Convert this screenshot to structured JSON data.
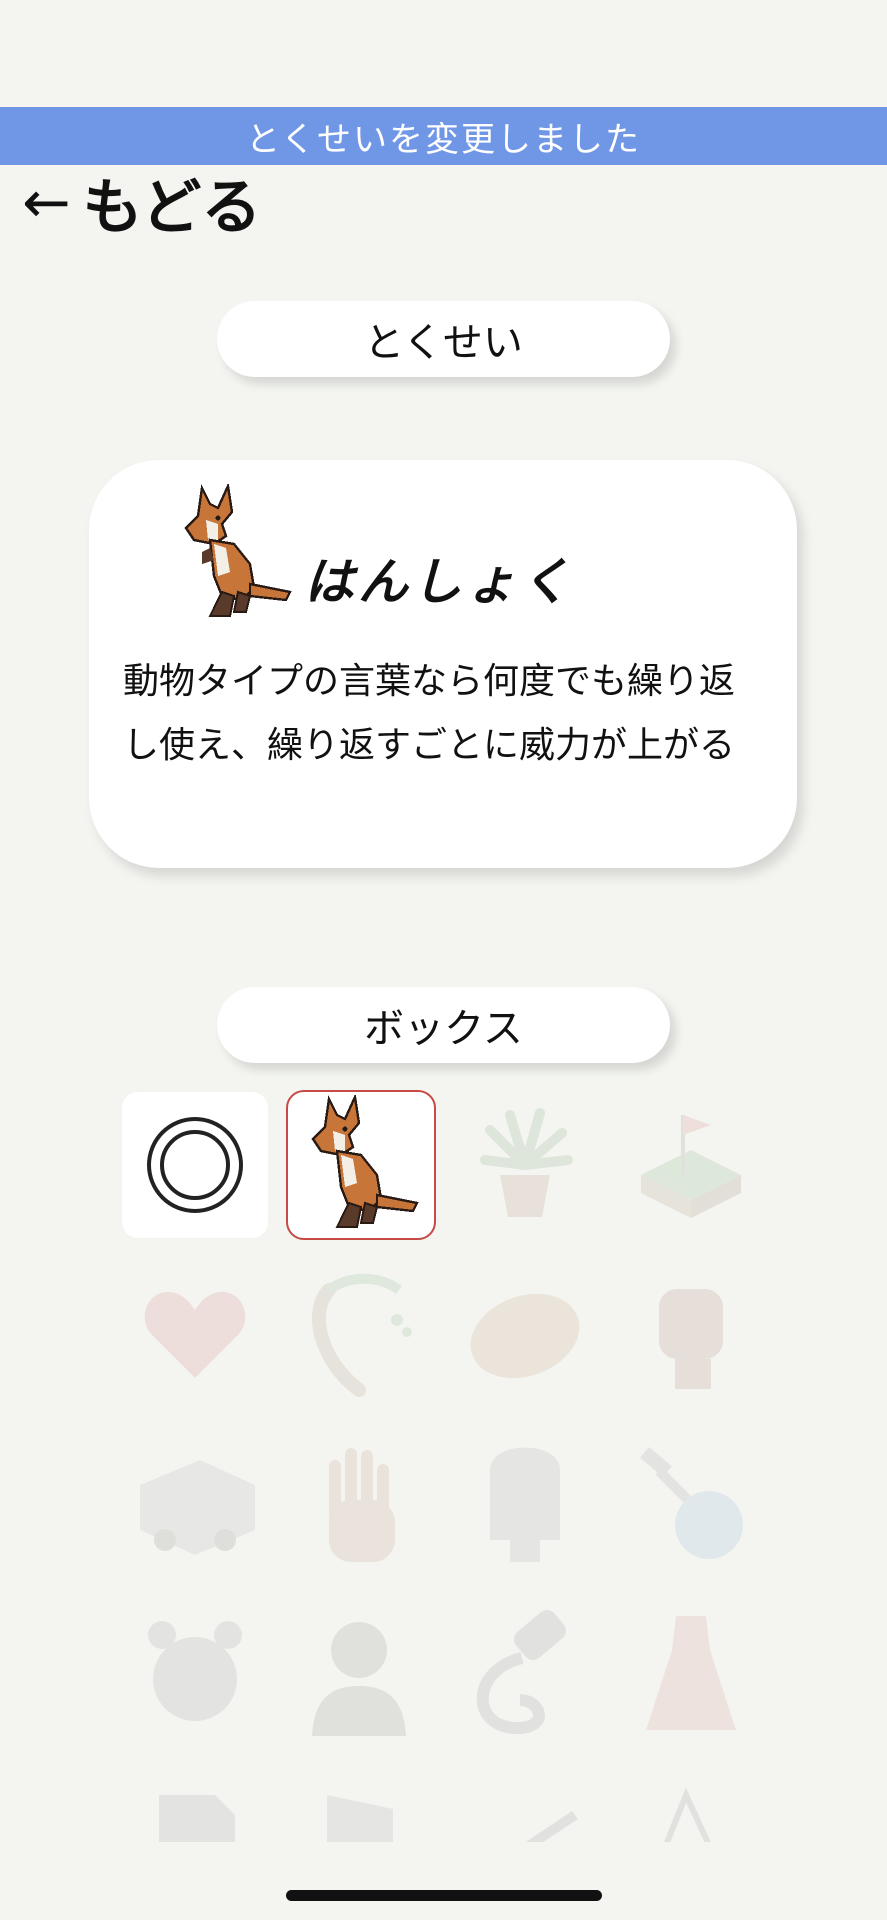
{
  "toast": {
    "text": "とくせいを変更しました"
  },
  "nav": {
    "back_arrow": "←",
    "back_label": "もどる"
  },
  "ability_section": {
    "title": "とくせい"
  },
  "ability_card": {
    "name": "はんしょく",
    "description": "動物タイプの言葉なら何度でも繰り返し使え、繰り返すごとに威力が上がる",
    "sprite_icon": "kangaroo-icon"
  },
  "box_section": {
    "title": "ボックス",
    "items": [
      {
        "icon": "ring-icon",
        "state": "available"
      },
      {
        "icon": "kangaroo-icon",
        "state": "selected"
      },
      {
        "icon": "potted-plant-icon",
        "state": "locked"
      },
      {
        "icon": "golf-green-icon",
        "state": "locked"
      },
      {
        "icon": "heart-icon",
        "state": "locked"
      },
      {
        "icon": "scythe-icon",
        "state": "locked"
      },
      {
        "icon": "bread-icon",
        "state": "locked"
      },
      {
        "icon": "fist-icon",
        "state": "locked"
      },
      {
        "icon": "ambulance-icon",
        "state": "locked"
      },
      {
        "icon": "open-hand-icon",
        "state": "locked"
      },
      {
        "icon": "ghost-icon",
        "state": "locked"
      },
      {
        "icon": "flask-icon",
        "state": "locked"
      },
      {
        "icon": "alarm-clock-icon",
        "state": "locked"
      },
      {
        "icon": "man-portrait-icon",
        "state": "locked"
      },
      {
        "icon": "hair-dryer-icon",
        "state": "locked"
      },
      {
        "icon": "dress-icon",
        "state": "locked"
      },
      {
        "icon": "chart-document-icon",
        "state": "locked"
      },
      {
        "icon": "flag-document-icon",
        "state": "locked"
      },
      {
        "icon": "pen-icon",
        "state": "locked"
      },
      {
        "icon": "triangle-icon",
        "state": "locked"
      }
    ]
  },
  "colors": {
    "background": "#f4f5f1",
    "toast": "#7096e6",
    "selected_border": "#c64a45"
  }
}
